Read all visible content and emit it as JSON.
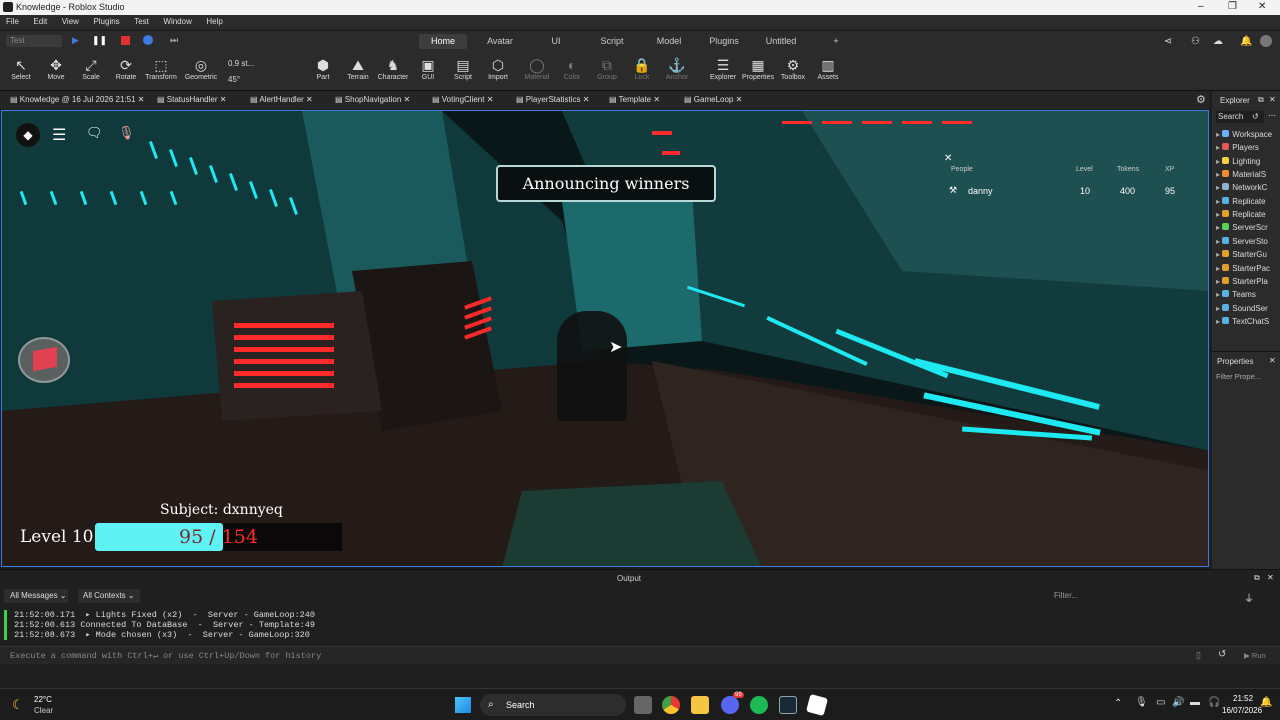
{
  "window": {
    "title": "Knowledge - Roblox Studio",
    "controls": [
      "–",
      "❐",
      "✕"
    ]
  },
  "menu": [
    "File",
    "Edit",
    "View",
    "Plugins",
    "Test",
    "Window",
    "Help"
  ],
  "test_dropdown": "Test",
  "ribbon_tabs": [
    "Home",
    "Avatar",
    "UI",
    "Script",
    "Model",
    "Plugins",
    "Untitled",
    "+"
  ],
  "active_ribbon_tab": "Home",
  "tools": [
    {
      "icon": "select-icon",
      "glyph": "↖",
      "label": "Select"
    },
    {
      "icon": "move-icon",
      "glyph": "✥",
      "label": "Move"
    },
    {
      "icon": "scale-icon",
      "glyph": "⤢",
      "label": "Scale"
    },
    {
      "icon": "rotate-icon",
      "glyph": "⟳",
      "label": "Rotate"
    },
    {
      "icon": "transform-icon",
      "glyph": "⬚",
      "label": "Transform"
    },
    {
      "icon": "geometric-icon",
      "glyph": "◎",
      "label": "Geometric"
    },
    {
      "icon": "part-icon",
      "glyph": "⬢",
      "label": "Part"
    },
    {
      "icon": "terrain-icon",
      "glyph": "⛰",
      "label": "Terrain"
    },
    {
      "icon": "character-icon",
      "glyph": "♞",
      "label": "Character"
    },
    {
      "icon": "gui-icon",
      "glyph": "▣",
      "label": "GUI"
    },
    {
      "icon": "script-icon",
      "glyph": "▤",
      "label": "Script"
    },
    {
      "icon": "import-icon",
      "glyph": "⬡",
      "label": "Import"
    },
    {
      "icon": "material-icon",
      "glyph": "◯",
      "label": "Material"
    },
    {
      "icon": "color-icon",
      "glyph": "◐",
      "label": "Color"
    },
    {
      "icon": "group-icon",
      "glyph": "⧉",
      "label": "Group"
    },
    {
      "icon": "lock-icon",
      "glyph": "🔒",
      "label": "Lock"
    },
    {
      "icon": "anchor-icon",
      "glyph": "⚓",
      "label": "Anchor"
    },
    {
      "icon": "explorer-icon",
      "glyph": "☰",
      "label": "Explorer"
    },
    {
      "icon": "properties-icon",
      "glyph": "▦",
      "label": "Properties"
    },
    {
      "icon": "toolbox-icon",
      "glyph": "⚙",
      "label": "Toolbox"
    },
    {
      "icon": "assets-icon",
      "glyph": "▥",
      "label": "Assets"
    }
  ],
  "snap": {
    "move": "0.9 st...",
    "rotate": "45°"
  },
  "doc_tabs": [
    "Knowledge @ 16 Jul 2026 21:51",
    "StatusHandler",
    "AlertHandler",
    "ShopNavigation",
    "VotingClient",
    "PlayerStatistics",
    "Template",
    "GameLoop"
  ],
  "game": {
    "banner": "Announcing winners",
    "subject": "Subject: dxnnyeq",
    "level_label": "Level 10",
    "xp_current": "95",
    "xp_sep": "/",
    "xp_max": "154",
    "xp_fraction": 0.617,
    "leaderboard": {
      "headers": [
        "People",
        "Level",
        "Tokens",
        "XP"
      ],
      "rows": [
        {
          "name": "danny",
          "level": "10",
          "tokens": "400",
          "xp": "95"
        }
      ]
    }
  },
  "explorer": {
    "title": "Explorer",
    "search": "Search",
    "items": [
      {
        "label": "Workspace",
        "color": "#6ab0ff"
      },
      {
        "label": "Players",
        "color": "#e05a5a"
      },
      {
        "label": "Lighting",
        "color": "#f5d142"
      },
      {
        "label": "MaterialS",
        "color": "#f08c30"
      },
      {
        "label": "NetworkC",
        "color": "#8fb0d0"
      },
      {
        "label": "Replicate",
        "color": "#5ab0e0"
      },
      {
        "label": "Replicate",
        "color": "#e0a030"
      },
      {
        "label": "ServerScr",
        "color": "#5ad05a"
      },
      {
        "label": "ServerSto",
        "color": "#5ab0e0"
      },
      {
        "label": "StarterGu",
        "color": "#e0a030"
      },
      {
        "label": "StarterPac",
        "color": "#e0a030"
      },
      {
        "label": "StarterPla",
        "color": "#e0a030"
      },
      {
        "label": "Teams",
        "color": "#5ab0e0"
      },
      {
        "label": "SoundSer",
        "color": "#5ab0e0"
      },
      {
        "label": "TextChatS",
        "color": "#5ab0e0"
      }
    ]
  },
  "properties": {
    "title": "Properties",
    "filter": "Filter Prope..."
  },
  "output": {
    "title": "Output",
    "filter_messages": "All Messages",
    "filter_contexts": "All Contexts",
    "filter_placeholder": "Filter...",
    "logs": [
      {
        "time": "21:52:00.171",
        "text": "  ▸ Lights Fixed (x2)  -  Server - GameLoop:240"
      },
      {
        "time": "21:52:00.613",
        "text": "Connected To DataBase  -  Server - Template:49"
      },
      {
        "time": "21:52:08.673",
        "text": "  ▸ Mode chosen (x3)  -  Server - GameLoop:320"
      }
    ],
    "command_placeholder": "Execute a command with Ctrl+↵ or use Ctrl+Up/Down for history",
    "run_label": "Run"
  },
  "taskbar": {
    "weather_temp": "22°C",
    "weather_desc": "Clear",
    "search": "Search",
    "time": "21:52",
    "date": "16/07/2026",
    "badge": "99"
  },
  "colors": {
    "accent": "#3d7be0",
    "xp_fill": "#5ef2f5",
    "xp_max": "#ff2a2a",
    "neon": "#1ee8f0"
  }
}
